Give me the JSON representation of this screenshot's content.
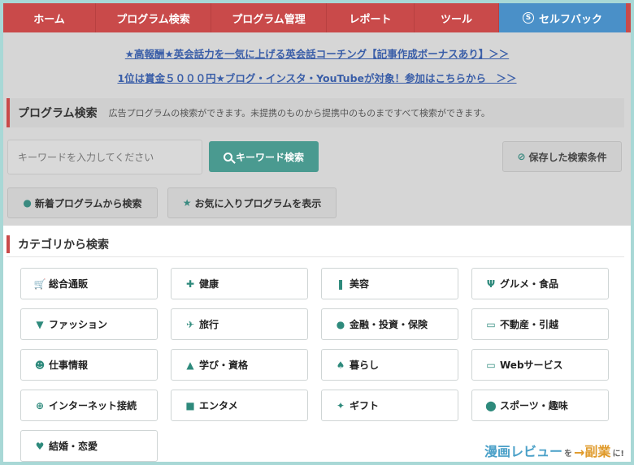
{
  "nav": {
    "items": [
      "ホーム",
      "プログラム検索",
      "プログラム管理",
      "レポート",
      "ツール"
    ],
    "self_back": "セルフバック",
    "self_icon": "S"
  },
  "promos": [
    "★高報酬★英会話力を一気に上げる英会話コーチング【記事作成ボーナスあり】＞＞",
    "1位は賞金５０００円★ブログ・インスタ・YouTubeが対象！参加はこちらから　＞＞"
  ],
  "search": {
    "title": "プログラム検索",
    "description": "広告プログラムの検索ができます。未提携のものから提携中のものまですべて検索ができます。",
    "placeholder": "キーワードを入力してください",
    "keyword_button": "キーワード検索",
    "saved_button": "保存した検索条件",
    "new_programs_button": "新着プログラムから検索",
    "favorites_button": "お気に入りプログラムを表示"
  },
  "categories": {
    "title": "カテゴリから検索",
    "items": [
      {
        "label": "総合通販",
        "icon": "cart-icon",
        "glyph": "🛒"
      },
      {
        "label": "健康",
        "icon": "first-aid-icon",
        "glyph": "✚"
      },
      {
        "label": "美容",
        "icon": "bottle-icon",
        "glyph": "❚"
      },
      {
        "label": "グルメ・食品",
        "icon": "cutlery-icon",
        "glyph": "Ψ"
      },
      {
        "label": "ファッション",
        "icon": "shirt-icon",
        "glyph": "▼"
      },
      {
        "label": "旅行",
        "icon": "airplane-icon",
        "glyph": "✈"
      },
      {
        "label": "金融・投資・保険",
        "icon": "money-bag-icon",
        "glyph": "●"
      },
      {
        "label": "不動産・引越",
        "icon": "truck-icon",
        "glyph": "▭"
      },
      {
        "label": "仕事情報",
        "icon": "person-icon",
        "glyph": "☻"
      },
      {
        "label": "学び・資格",
        "icon": "graduation-cap-icon",
        "glyph": "▲"
      },
      {
        "label": "暮らし",
        "icon": "house-icon",
        "glyph": "♠"
      },
      {
        "label": "Webサービス",
        "icon": "monitor-icon",
        "glyph": "▭"
      },
      {
        "label": "インターネット接続",
        "icon": "globe-icon",
        "glyph": "⊕"
      },
      {
        "label": "エンタメ",
        "icon": "camera-icon",
        "glyph": "■"
      },
      {
        "label": "ギフト",
        "icon": "gift-icon",
        "glyph": "✦"
      },
      {
        "label": "スポーツ・趣味",
        "icon": "sports-icon",
        "glyph": "⬤"
      },
      {
        "label": "結婚・恋愛",
        "icon": "heart-icon",
        "glyph": "♥"
      }
    ]
  },
  "watermark": {
    "part1": "漫画レビュー",
    "part2": "を",
    "arrow": "→",
    "part3": "副業",
    "part4": "に!"
  },
  "colors": {
    "nav_red": "#c94a4a",
    "nav_blue": "#4a90c8",
    "accent_teal": "#4a9a90",
    "promo_link": "#3a5ea8"
  }
}
